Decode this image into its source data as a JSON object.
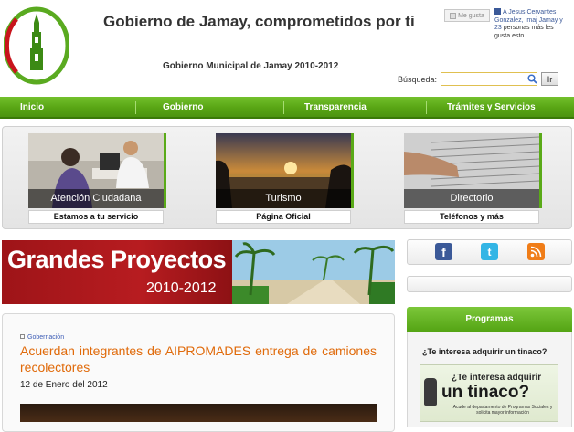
{
  "header": {
    "title": "Gobierno de Jamay, comprometidos por ti",
    "subtitle": "Gobierno Municipal de Jamay 2010-2012",
    "fb_like_label": "Me gusta",
    "fb_social_names": "A Jesus Cervantes Gonzalez, Imaj Jamay y 23",
    "fb_social_rest": "personas más les gusta esto.",
    "search_label": "Búsqueda:",
    "search_value": "",
    "search_button": "Ir"
  },
  "nav": {
    "items": [
      {
        "label": "Inicio"
      },
      {
        "label": "Gobierno"
      },
      {
        "label": "Transparencia"
      },
      {
        "label": "Trámites y Servicios"
      }
    ]
  },
  "quick_links": [
    {
      "image_caption": "Atención Ciudadana",
      "label": "Estamos a tu servicio"
    },
    {
      "image_caption": "Turismo",
      "label": "Página Oficial"
    },
    {
      "image_caption": "Directorio",
      "label": "Teléfonos y más"
    }
  ],
  "banner": {
    "title": "Grandes Proyectos",
    "years": "2010-2012"
  },
  "article": {
    "category": "Gobernación",
    "title": "Acuerdan integrantes de AIPROMADES entrega de camiones recolectores",
    "date": "12 de Enero del 2012"
  },
  "sidebar": {
    "social": [
      {
        "name": "facebook",
        "icon": "facebook-icon",
        "glyph": "f",
        "color": "#3b5998"
      },
      {
        "name": "twitter",
        "icon": "twitter-icon",
        "glyph": "t",
        "color": "#33b5e5"
      },
      {
        "name": "rss",
        "icon": "rss-icon",
        "glyph": "))",
        "color": "#f07d18"
      }
    ],
    "programas_title": "Programas",
    "programas_question": "¿Te interesa adquirir un tinaco?",
    "ad_line1": "¿Te interesa adquirir",
    "ad_line2": "un tinaco?",
    "ad_line3": "Acude al departamento de Programas Sociales y solicita mayor información"
  },
  "colors": {
    "nav_green": "#58a514",
    "article_title": "#e06a0a",
    "banner_red": "#b71c20"
  }
}
